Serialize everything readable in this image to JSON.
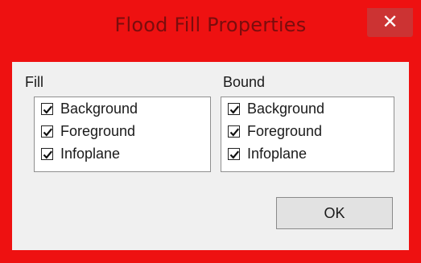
{
  "window": {
    "title": "Flood Fill Properties",
    "close_glyph": "✕",
    "frame_color": "#ee1111"
  },
  "fill_group": {
    "label": "Fill",
    "items": [
      {
        "label": "Background",
        "checked": true
      },
      {
        "label": "Foreground",
        "checked": true
      },
      {
        "label": "Infoplane",
        "checked": true
      }
    ]
  },
  "bound_group": {
    "label": "Bound",
    "items": [
      {
        "label": "Background",
        "checked": true
      },
      {
        "label": "Foreground",
        "checked": true
      },
      {
        "label": "Infoplane",
        "checked": true
      }
    ]
  },
  "buttons": {
    "ok_label": "OK"
  }
}
